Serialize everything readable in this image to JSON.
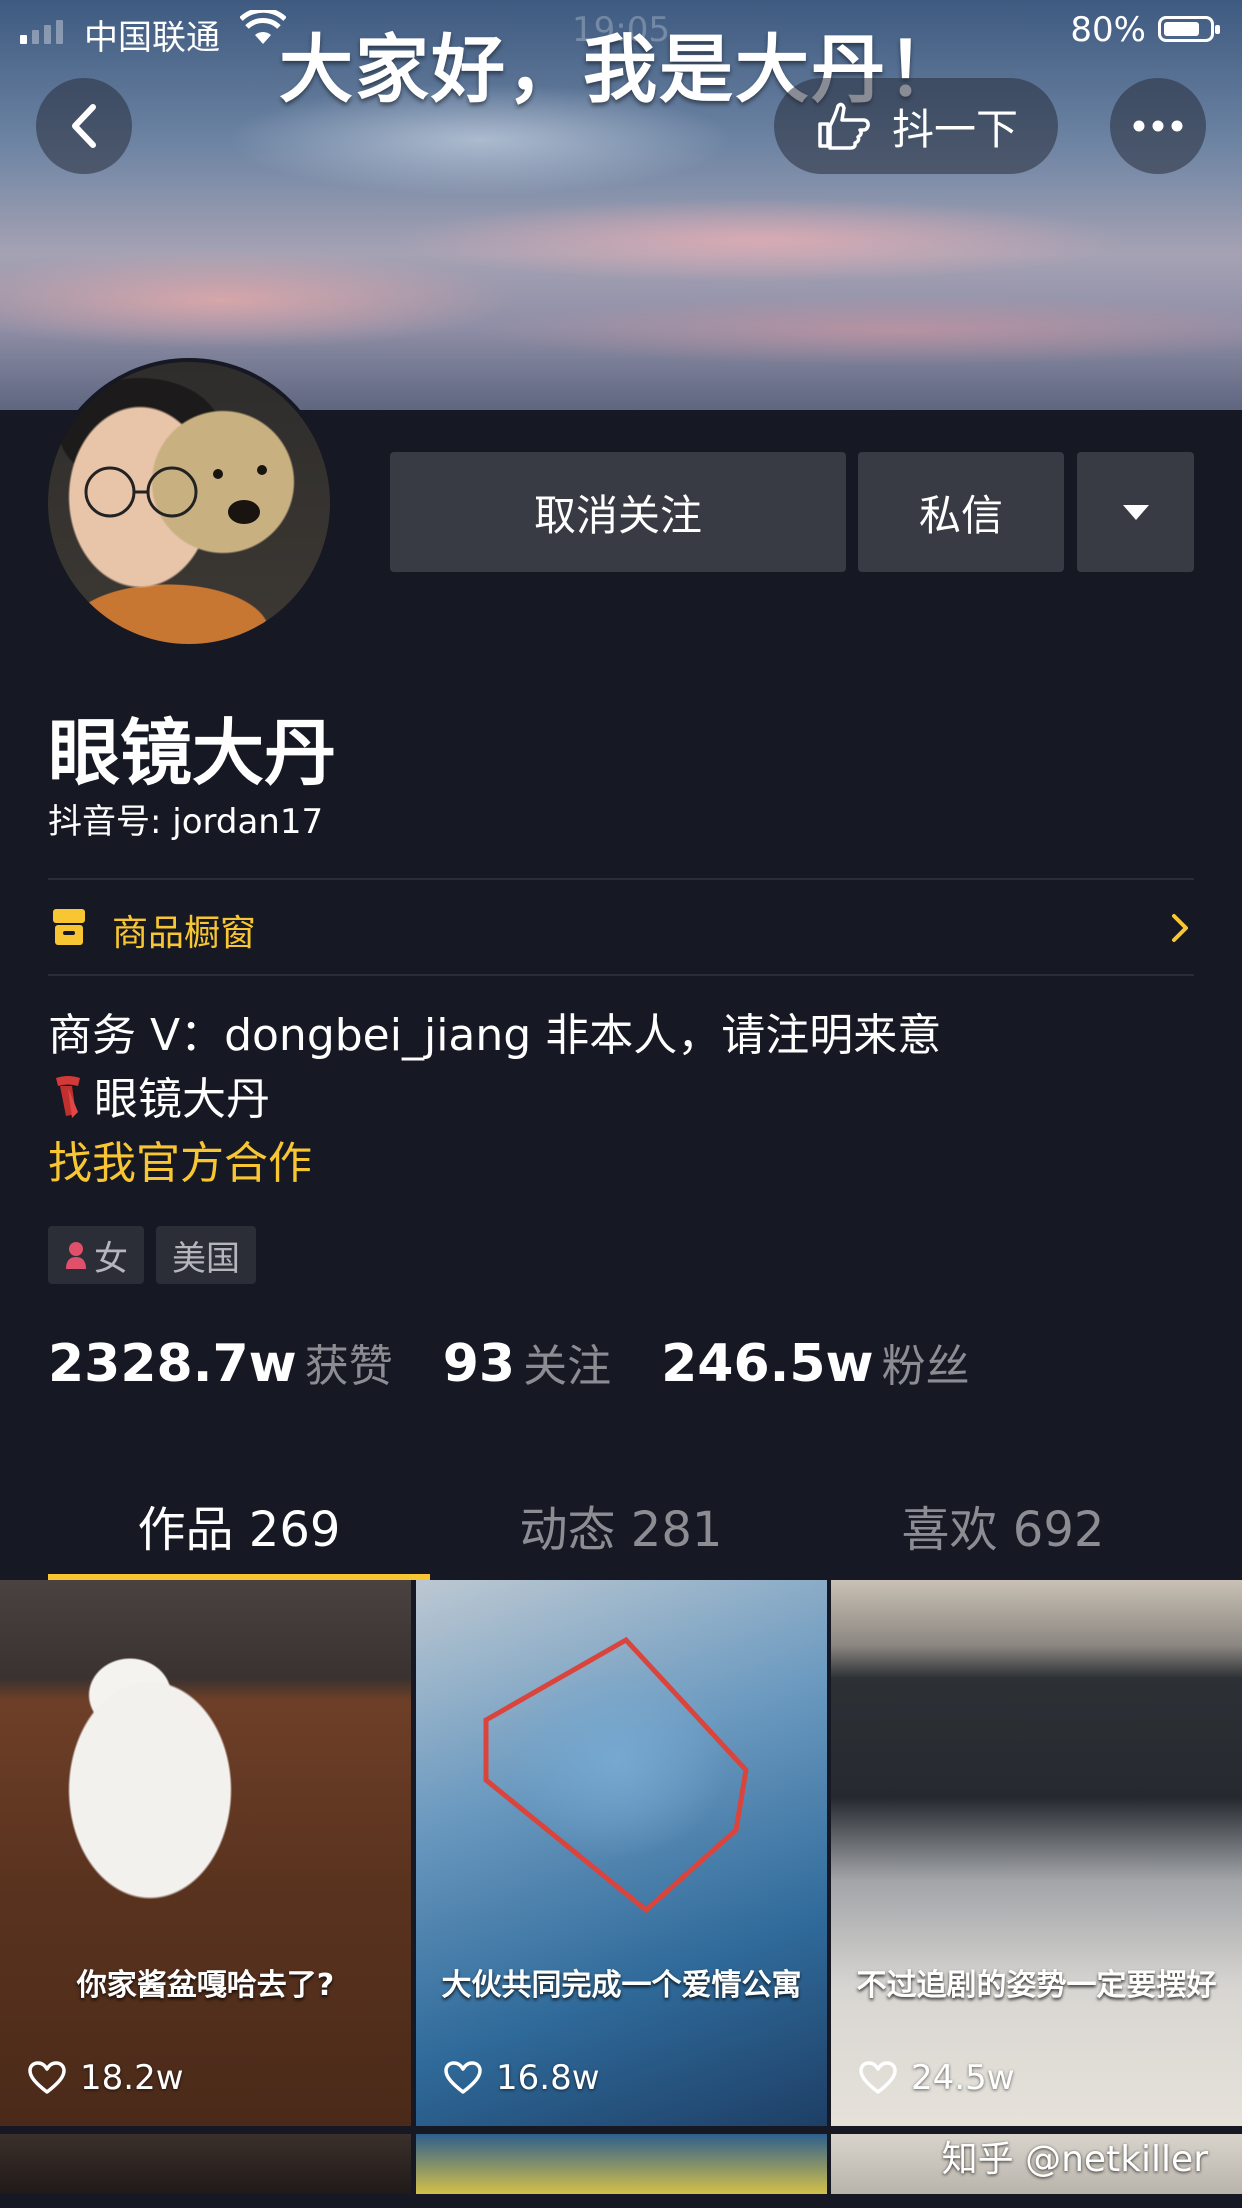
{
  "status_bar": {
    "carrier": "中国联通",
    "time": "19:05",
    "battery_percent": "80%",
    "battery_level": 0.8,
    "signal_bars": 1
  },
  "cover": {
    "headline": "大家好，我是大丹！"
  },
  "header_actions": {
    "back_icon": "chevron-left-icon",
    "poke_label": "抖一下",
    "poke_icon": "pointing-hand-icon",
    "more_icon": "ellipsis-icon"
  },
  "profile": {
    "nickname": "眼镜大丹",
    "douyin_id": "抖音号: jordan17",
    "buttons": {
      "unfollow": "取消关注",
      "message": "私信",
      "dropdown_icon": "triangle-down-icon"
    }
  },
  "shop": {
    "label": "商品橱窗",
    "icon": "storefront-icon",
    "chevron_icon": "chevron-right-icon"
  },
  "bio": {
    "line1": "商务 V：dongbei_jiang 非本人，请注明来意",
    "line2": "眼镜大丹",
    "line2_icon": "scarf-icon",
    "link": "找我官方合作"
  },
  "tags": [
    {
      "label": "女",
      "icon": "female-icon"
    },
    {
      "label": "美国"
    }
  ],
  "stats": [
    {
      "value": "2328.7w",
      "label": "获赞"
    },
    {
      "value": "93",
      "label": "关注"
    },
    {
      "value": "246.5w",
      "label": "粉丝"
    }
  ],
  "tabs": [
    {
      "label": "作品 269",
      "active": true
    },
    {
      "label": "动态 281",
      "active": false
    },
    {
      "label": "喜欢 692",
      "active": false
    }
  ],
  "videos": [
    {
      "caption": "你家酱盆嘎哈去了?",
      "likes": "18.2w"
    },
    {
      "caption": "大伙共同完成一个爱情公寓",
      "likes": "16.8w"
    },
    {
      "caption": "不过追剧的姿势一定要摆好",
      "likes": "24.5w"
    }
  ],
  "watermark": "知乎 @netkiller",
  "colors": {
    "background": "#161823",
    "accent": "#f8c632",
    "button": "#393b44",
    "muted_text": "#8c8d93"
  }
}
